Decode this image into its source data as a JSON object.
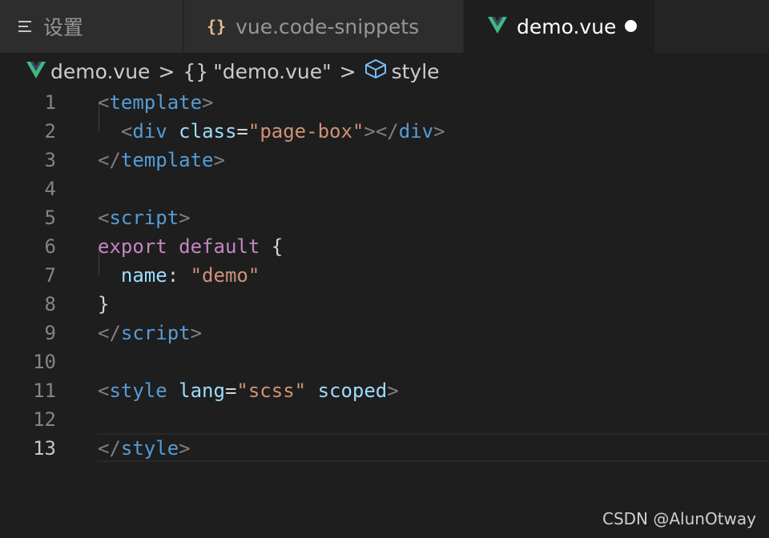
{
  "tabs": [
    {
      "label": "设置",
      "icon": "settings-list-icon"
    },
    {
      "label": "vue.code-snippets",
      "icon": "curly-braces-icon"
    },
    {
      "label": "demo.vue",
      "icon": "vue-logo-icon",
      "active": true,
      "unsaved": true
    }
  ],
  "breadcrumb": {
    "file": "demo.vue",
    "separator": ">",
    "object_icon": "{}",
    "object": "\"demo.vue\"",
    "symbol": "style"
  },
  "editor": {
    "line_numbers": [
      "1",
      "2",
      "3",
      "4",
      "5",
      "6",
      "7",
      "8",
      "9",
      "10",
      "11",
      "12",
      "13"
    ],
    "active_line": "13",
    "lines": [
      [
        [
          "tag",
          "<"
        ],
        [
          "name",
          "template"
        ],
        [
          "tag",
          ">"
        ]
      ],
      [
        [
          "plain",
          "  "
        ],
        [
          "tag",
          "<"
        ],
        [
          "name",
          "div"
        ],
        [
          "plain",
          " "
        ],
        [
          "attr",
          "class"
        ],
        [
          "plain",
          "="
        ],
        [
          "str",
          "\"page-box\""
        ],
        [
          "tag",
          "></"
        ],
        [
          "name",
          "div"
        ],
        [
          "tag",
          ">"
        ]
      ],
      [
        [
          "tag",
          "</"
        ],
        [
          "name",
          "template"
        ],
        [
          "tag",
          ">"
        ]
      ],
      [],
      [
        [
          "tag",
          "<"
        ],
        [
          "name",
          "script"
        ],
        [
          "tag",
          ">"
        ]
      ],
      [
        [
          "kw",
          "export"
        ],
        [
          "plain",
          " "
        ],
        [
          "kw",
          "default"
        ],
        [
          "plain",
          " {"
        ]
      ],
      [
        [
          "plain",
          "  "
        ],
        [
          "attr",
          "name"
        ],
        [
          "plain",
          ": "
        ],
        [
          "str",
          "\"demo\""
        ]
      ],
      [
        [
          "plain",
          "}"
        ]
      ],
      [
        [
          "tag",
          "</"
        ],
        [
          "name",
          "script"
        ],
        [
          "tag",
          ">"
        ]
      ],
      [],
      [
        [
          "tag",
          "<"
        ],
        [
          "name",
          "style"
        ],
        [
          "plain",
          " "
        ],
        [
          "attr",
          "lang"
        ],
        [
          "plain",
          "="
        ],
        [
          "str",
          "\"scss\""
        ],
        [
          "plain",
          " "
        ],
        [
          "attr",
          "scoped"
        ],
        [
          "tag",
          ">"
        ]
      ],
      [],
      [
        [
          "tag",
          "</"
        ],
        [
          "name",
          "style"
        ],
        [
          "tag",
          ">"
        ]
      ]
    ]
  },
  "watermark": "CSDN @AlunOtway",
  "colors": {
    "vue_green": "#41b883",
    "vue_dark": "#35495e",
    "tag": "#808080",
    "tag_name": "#569cd6",
    "attribute": "#9cdcfe",
    "string": "#ce9178",
    "keyword": "#c586c0"
  }
}
